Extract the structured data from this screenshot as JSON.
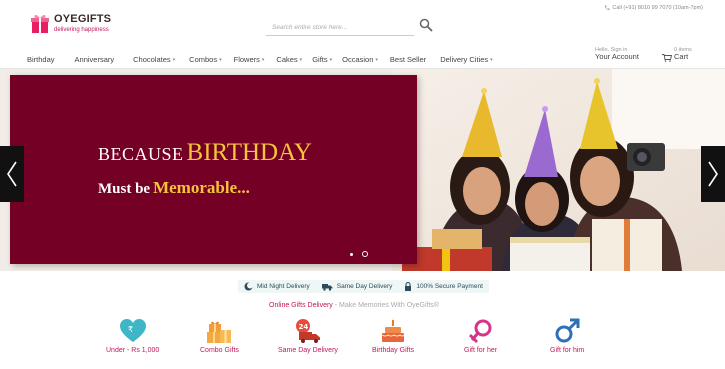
{
  "header": {
    "logo_name": "OYEGIFTS",
    "logo_tagline": "delivering happiness",
    "search_placeholder": "Search entire store here...",
    "phone": "Call (+91) 8010 99 7070 (10am-7pm)",
    "account_small": "Hello. Sign in",
    "account_label": "Your Account",
    "cart_small": "0 items",
    "cart_label": "Cart"
  },
  "nav": [
    {
      "label": "Birthday",
      "has_caret": false
    },
    {
      "label": "Anniversary",
      "has_caret": false
    },
    {
      "label": "Chocolates",
      "has_caret": true
    },
    {
      "label": "Combos",
      "has_caret": true
    },
    {
      "label": "Flowers",
      "has_caret": true
    },
    {
      "label": "Cakes",
      "has_caret": true
    },
    {
      "label": "Gifts",
      "has_caret": true
    },
    {
      "label": "Occasion",
      "has_caret": true
    },
    {
      "label": "Best Seller",
      "has_caret": false
    },
    {
      "label": "Delivery Cities",
      "has_caret": true
    }
  ],
  "banner": {
    "line1_a": "BECAUSE",
    "line1_b": "BIRTHDAY",
    "line2_a": "Must be",
    "line2_b": "Memorable...",
    "slide_count": 2,
    "active_slide": 1
  },
  "features": [
    {
      "label": "Mid Night Delivery",
      "icon": "moon-icon"
    },
    {
      "label": "Same Day Delivery",
      "icon": "truck-icon"
    },
    {
      "label": "100% Secure Payment",
      "icon": "lock-icon"
    }
  ],
  "tagline": {
    "title": "Online Gifts Delivery",
    "subtitle": "- Make Memories With OyeGifts®"
  },
  "categories": [
    {
      "label": "Under - Rs 1,000",
      "icon": "heart-rupee-icon"
    },
    {
      "label": "Combo Gifts",
      "icon": "gift-boxes-icon"
    },
    {
      "label": "Same Day Delivery",
      "icon": "delivery-truck-icon"
    },
    {
      "label": "Birthday Gifts",
      "icon": "birthday-cake-icon"
    },
    {
      "label": "Gift for her",
      "icon": "female-symbol-icon"
    },
    {
      "label": "Gift for him",
      "icon": "male-symbol-icon"
    }
  ],
  "colors": {
    "brand_pink": "#c2185b",
    "banner_maroon": "#750025",
    "banner_gold": "#f4c53a",
    "teal": "#2aa7b8"
  }
}
